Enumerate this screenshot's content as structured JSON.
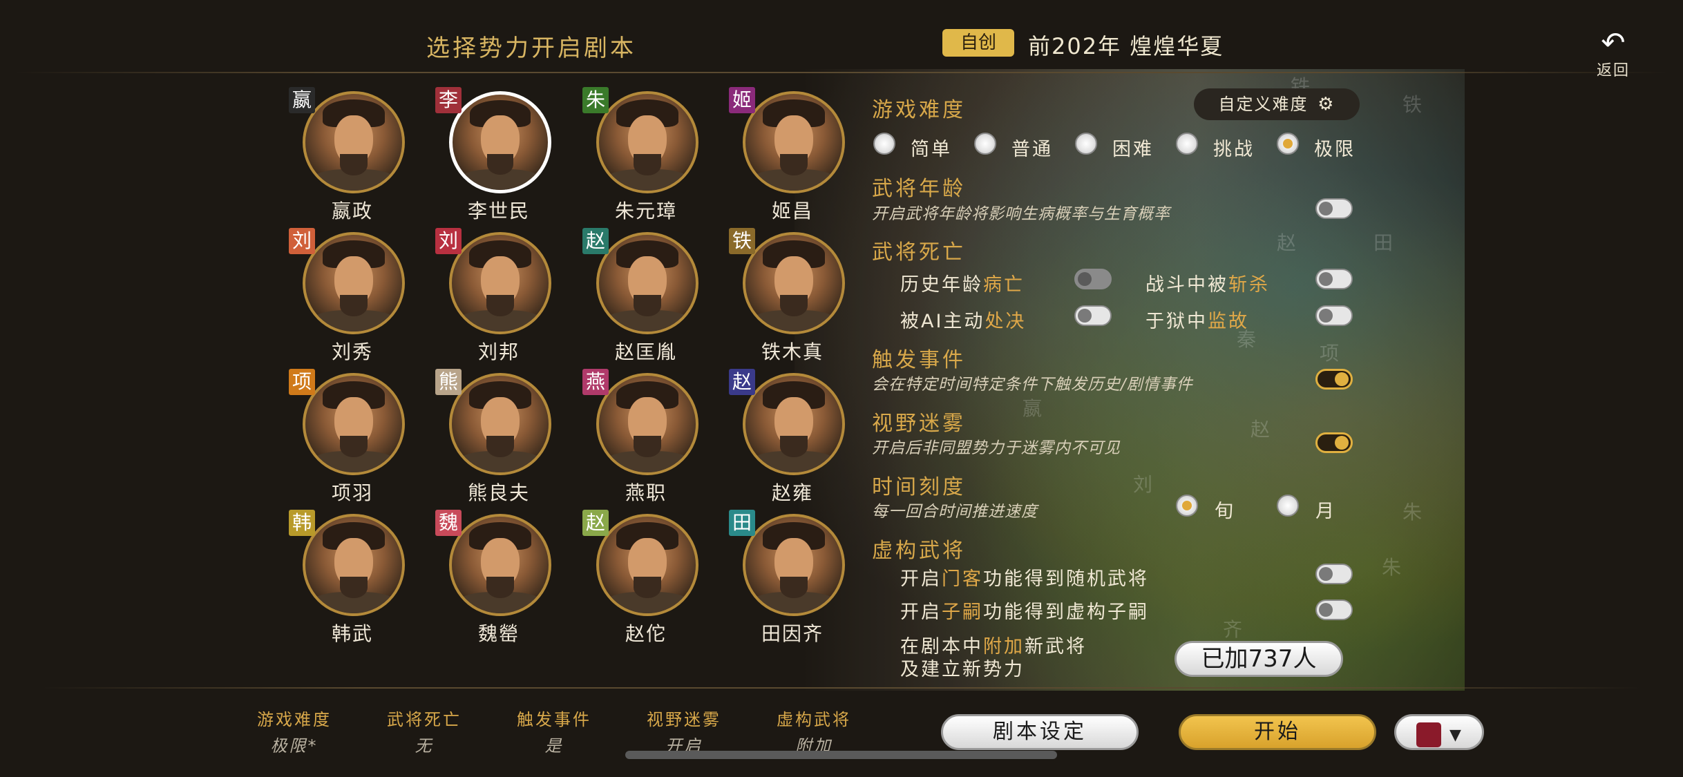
{
  "header": {
    "title": "选择势力开启剧本",
    "badge": "自创",
    "era": "前202年  煌煌华夏",
    "back_label": "返回"
  },
  "characters": [
    {
      "tag": "嬴",
      "tag_color": "#2a2a2a",
      "name": "嬴政"
    },
    {
      "tag": "李",
      "tag_color": "#a0303a",
      "name": "李世民",
      "selected": true
    },
    {
      "tag": "朱",
      "tag_color": "#3a7a2a",
      "name": "朱元璋"
    },
    {
      "tag": "姬",
      "tag_color": "#8a2a7a",
      "name": "姬昌"
    },
    {
      "tag": "刘",
      "tag_color": "#d0603a",
      "name": "刘秀"
    },
    {
      "tag": "刘",
      "tag_color": "#b83040",
      "name": "刘邦"
    },
    {
      "tag": "赵",
      "tag_color": "#2a7a6a",
      "name": "赵匡胤"
    },
    {
      "tag": "铁",
      "tag_color": "#8a6a2a",
      "name": "铁木真"
    },
    {
      "tag": "项",
      "tag_color": "#d07a1a",
      "name": "项羽"
    },
    {
      "tag": "熊",
      "tag_color": "#b8a48a",
      "name": "熊良夫"
    },
    {
      "tag": "燕",
      "tag_color": "#b03a6a",
      "name": "燕职"
    },
    {
      "tag": "赵",
      "tag_color": "#3a3a8a",
      "name": "赵雍"
    },
    {
      "tag": "韩",
      "tag_color": "#b89a2a",
      "name": "韩武"
    },
    {
      "tag": "魏",
      "tag_color": "#c84a5a",
      "name": "魏罃"
    },
    {
      "tag": "赵",
      "tag_color": "#8aa84a",
      "name": "赵佗"
    },
    {
      "tag": "田",
      "tag_color": "#2a8a8a",
      "name": "田因齐"
    }
  ],
  "settings": {
    "difficulty": {
      "title": "游戏难度",
      "custom_button": "自定义难度",
      "options": [
        "简单",
        "普通",
        "困难",
        "挑战",
        "极限"
      ],
      "selected": "极限"
    },
    "age": {
      "title": "武将年龄",
      "desc": "开启武将年龄将影响生病概率与生育概率",
      "on": false
    },
    "death": {
      "title": "武将死亡",
      "items": [
        {
          "pre": "历史年龄",
          "hl": "病亡",
          "post": "",
          "on": false
        },
        {
          "pre": "战斗中被",
          "hl": "斩杀",
          "post": "",
          "on": false
        },
        {
          "pre": "被AI主动",
          "hl": "处决",
          "post": "",
          "on": false
        },
        {
          "pre": "于狱中",
          "hl": "监故",
          "post": "",
          "on": false
        }
      ]
    },
    "events": {
      "title": "触发事件",
      "desc": "会在特定时间特定条件下触发历史/剧情事件",
      "on": true
    },
    "fog": {
      "title": "视野迷雾",
      "desc": "开启后非同盟势力于迷雾内不可见",
      "on": true
    },
    "time": {
      "title": "时间刻度",
      "desc": "每一回合时间推进速度",
      "options": [
        "旬",
        "月"
      ],
      "selected": "旬"
    },
    "fictional": {
      "title": "虚构武将",
      "line1_pre": "开启",
      "line1_hl": "门客",
      "line1_post": "功能得到随机武将",
      "line2_pre": "开启",
      "line2_hl": "子嗣",
      "line2_post": "功能得到虚构子嗣",
      "line3_pre": "在剧本中",
      "line3_hl": "附加",
      "line3_post": "新武将",
      "line4": "及建立新势力",
      "added_button": "已加737人"
    }
  },
  "footer": {
    "summary": [
      {
        "label": "游戏难度",
        "value": "极限*"
      },
      {
        "label": "武将死亡",
        "value": "无"
      },
      {
        "label": "触发事件",
        "value": "是"
      },
      {
        "label": "视野迷雾",
        "value": "开启"
      },
      {
        "label": "虚构武将",
        "value": "附加"
      }
    ],
    "scenario_button": "剧本设定",
    "start_button": "开始",
    "color_swatch": "#8a1a2a"
  },
  "map_labels": [
    "铁",
    "铁",
    "赵",
    "田",
    "秦",
    "项",
    "刘",
    "朱",
    "朱",
    "嬴",
    "赵",
    "齐"
  ]
}
